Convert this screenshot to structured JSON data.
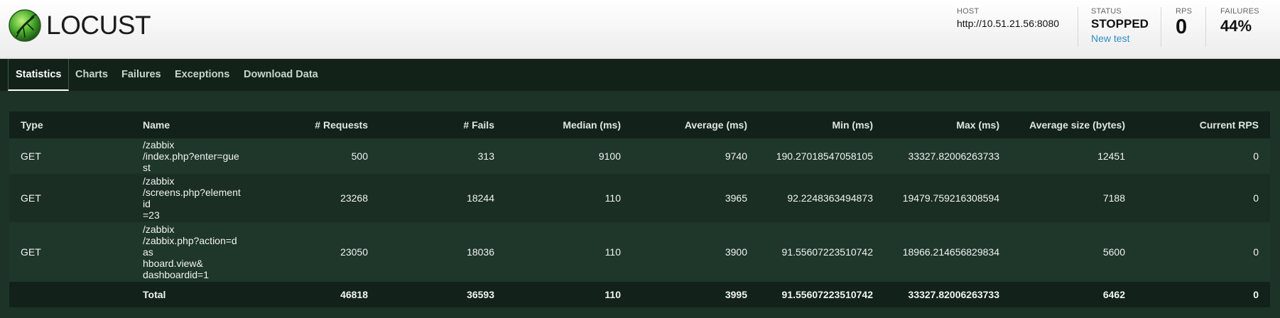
{
  "app": {
    "logo_text": "LOCUST"
  },
  "header": {
    "host_label": "HOST",
    "host_value": "http://10.51.21.56:8080",
    "status_label": "STATUS",
    "status_value": "STOPPED",
    "new_test_link": "New test",
    "rps_label": "RPS",
    "rps_value": "0",
    "failures_label": "FAILURES",
    "failures_value": "44%"
  },
  "tabs": [
    {
      "label": "Statistics",
      "active": true
    },
    {
      "label": "Charts",
      "active": false
    },
    {
      "label": "Failures",
      "active": false
    },
    {
      "label": "Exceptions",
      "active": false
    },
    {
      "label": "Download Data",
      "active": false
    }
  ],
  "table": {
    "columns": [
      "Type",
      "Name",
      "# Requests",
      "# Fails",
      "Median (ms)",
      "Average (ms)",
      "Min (ms)",
      "Max (ms)",
      "Average size (bytes)",
      "Current RPS"
    ],
    "rows": [
      [
        "GET",
        "/zabbix\n/index.php?enter=guest",
        "500",
        "313",
        "9100",
        "9740",
        "190.27018547058105",
        "33327.82006263733",
        "12451",
        "0"
      ],
      [
        "GET",
        "/zabbix\n/screens.php?elementid\n=23",
        "23268",
        "18244",
        "110",
        "3965",
        "92.2248363494873",
        "19479.759216308594",
        "7188",
        "0"
      ],
      [
        "GET",
        "/zabbix\n/zabbix.php?action=das\nhboard.view&\ndashboardid=1",
        "23050",
        "18036",
        "110",
        "3900",
        "91.55607223510742",
        "18966.214656829834",
        "5600",
        "0"
      ]
    ],
    "total": [
      "",
      "Total",
      "46818",
      "36593",
      "110",
      "3995",
      "91.55607223510742",
      "33327.82006263733",
      "6462",
      "0"
    ]
  },
  "icons": {
    "logo": "locust-logo-icon"
  },
  "colors": {
    "background": "#1e3327",
    "tab_bar": "#132219",
    "link": "#2e8ec7"
  }
}
